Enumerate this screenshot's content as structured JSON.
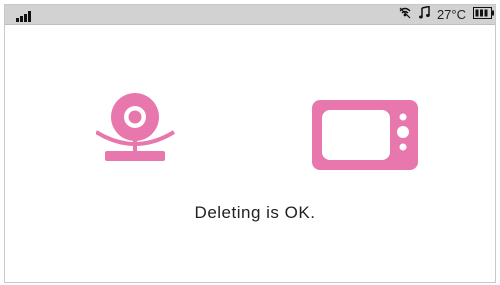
{
  "status_bar": {
    "signal_icon": "signal-strength-icon",
    "wifi_icon": "wifi-icon",
    "music_icon": "music-note-icon",
    "temperature": "27°C",
    "battery_icon": "battery-icon"
  },
  "main": {
    "camera_icon": "camera-icon",
    "monitor_icon": "monitor-icon",
    "message": "Deleting is OK."
  },
  "colors": {
    "accent": "#e877ad",
    "status_bar_bg": "#d2d2d2",
    "text": "#222222"
  }
}
